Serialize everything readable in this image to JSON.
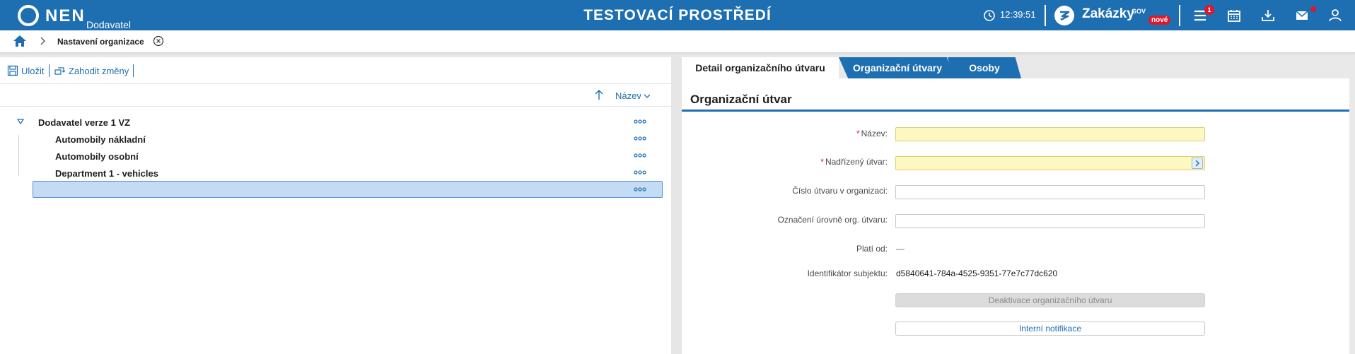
{
  "topbar": {
    "logo_text": "NEN",
    "logo_subtitle": "Dodavatel",
    "environment_title": "TESTOVACÍ PROSTŘEDÍ",
    "clock_time": "12:39:51",
    "zakazky_label": "Zakázky",
    "zakazky_gov": "GOV",
    "zakazky_badge": "nové",
    "menu_badge_count": "1",
    "accent_color": "#1e6fb2",
    "badge_color": "#e0162b",
    "icons": [
      "clock-icon",
      "zakazky-logo-icon",
      "menu-icon",
      "calendar-icon",
      "download-icon",
      "mail-icon",
      "user-icon"
    ]
  },
  "breadcrumb": {
    "current": "Nastavení organizace"
  },
  "toolbar": {
    "save_label": "Uložit",
    "discard_label": "Zahodit změny"
  },
  "sort": {
    "label": "Název"
  },
  "tree": {
    "root": "Dodavatel verze 1 VZ",
    "children": [
      "Automobily nákladní",
      "Automobily osobní",
      "Department 1 - vehicles"
    ],
    "selected_label": ""
  },
  "tabs": [
    {
      "label": "Detail organizačního útvaru",
      "active": true
    },
    {
      "label": "Organizační útvary",
      "active": false
    },
    {
      "label": "Osoby",
      "active": false
    }
  ],
  "detail": {
    "section_title": "Organizační útvar",
    "fields": {
      "nazev": {
        "label": "Název:",
        "value": "",
        "required": true
      },
      "nadrizeny": {
        "label": "Nadřízený útvar:",
        "value": "",
        "required": true
      },
      "cislo": {
        "label": "Číslo útvaru v organizaci:",
        "value": ""
      },
      "oznaceni": {
        "label": "Označení úrovně org. útvaru:",
        "value": ""
      },
      "plati_od": {
        "label": "Platí od:",
        "value": "—"
      },
      "identifikator": {
        "label": "Identifikátor subjektu:",
        "value": "d5840641-784a-4525-9351-77e7c77dc620"
      }
    },
    "deactivate_button": "Deaktivace organizačního útvaru",
    "notifications_button": "Interní notifikace"
  }
}
